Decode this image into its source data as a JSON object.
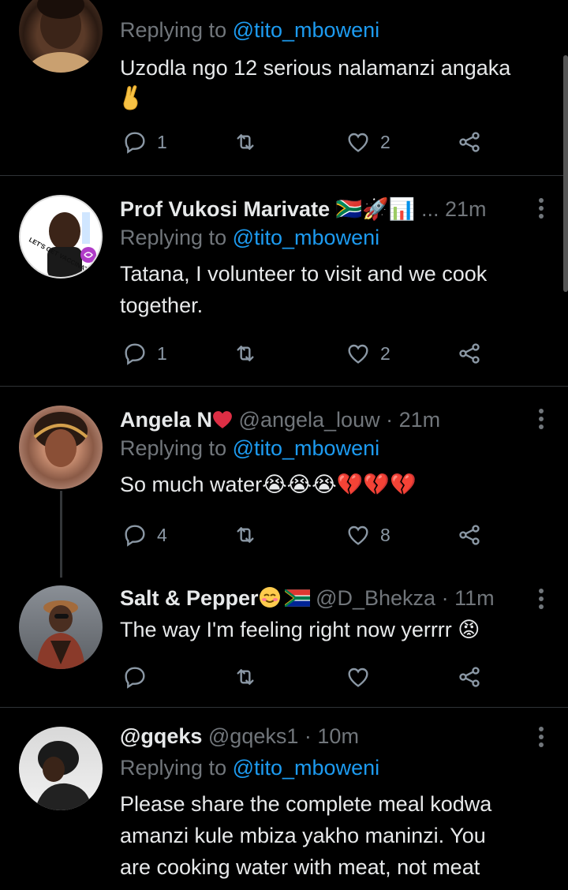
{
  "tweets": [
    {
      "name": "",
      "handle": "",
      "time": "",
      "replying_prefix": "Replying to",
      "replying_to": "@tito_mboweni",
      "text": "Uzodla ngo 12 serious nalamanzi angaka",
      "extra_text": "🤞",
      "replies": "1",
      "retweets": "",
      "likes": "2"
    },
    {
      "name": "Prof Vukosi Marivate",
      "name_suffix": "🇿🇦🚀📊 ...",
      "handle": "",
      "time": "21m",
      "replying_prefix": "Replying to",
      "replying_to": "@tito_mboweni",
      "text_line1": "Tatana, I volunteer to visit and we cook",
      "text_line2": "together.",
      "avatar_text": "LET'S GET VACCINATED",
      "replies": "1",
      "retweets": "",
      "likes": "2"
    },
    {
      "name": "Angela N",
      "handle": "@angela_louw",
      "time": "21m",
      "replying_prefix": "Replying to",
      "replying_to": "@tito_mboweni",
      "text": "So much water😭😭😭💔💔💔",
      "replies": "4",
      "retweets": "",
      "likes": "8"
    },
    {
      "name": "Salt & Pepper",
      "handle": "@D_Bhekza",
      "time": "11m",
      "text": "The way I'm feeling right now yerrrr 😡",
      "replies": "",
      "retweets": "",
      "likes": ""
    },
    {
      "name": "@gqeks",
      "handle": "@gqeks1",
      "time": "10m",
      "replying_prefix": "Replying to",
      "replying_to": "@tito_mboweni",
      "text_line1": "Please share the complete meal kodwa",
      "text_line2": "amanzi kule mbiza yakho maninzi. You",
      "text_line3": "are cooking water with meat, not meat"
    }
  ],
  "separator": "·",
  "colors": {
    "accent": "#1d9bf0",
    "muted": "#71767b",
    "like_red": "#e0245e",
    "background": "#000000"
  }
}
